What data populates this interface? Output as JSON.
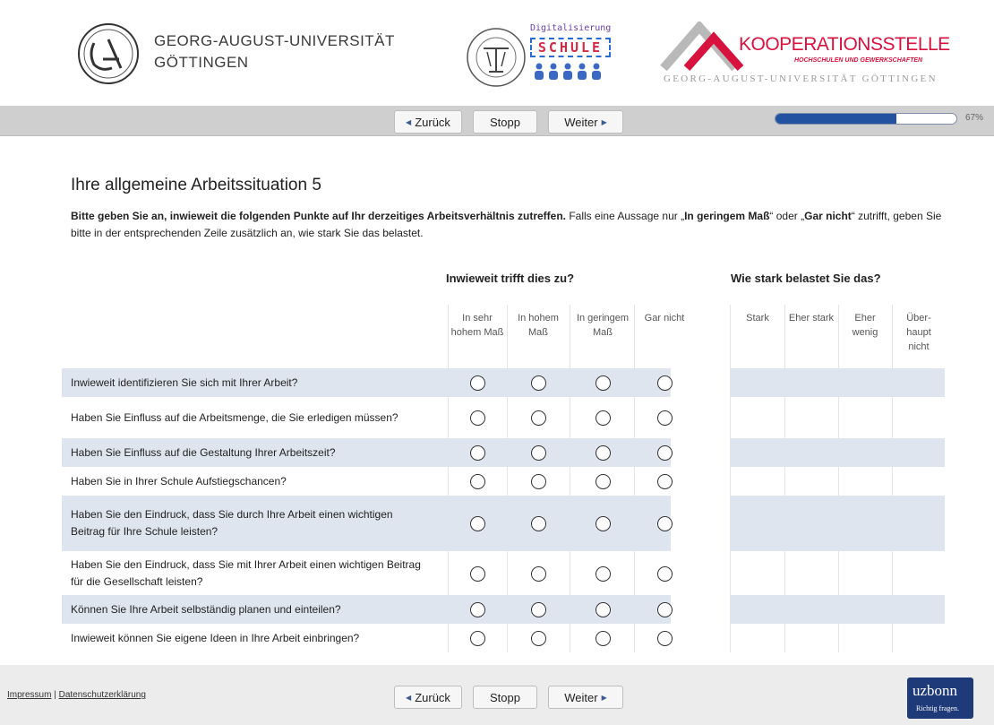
{
  "header": {
    "university_name_line1": "GEORG-AUGUST-UNIVERSITÄT",
    "university_name_line2": "GÖTTINGEN",
    "digital_logo_title": "Digitalisierung",
    "digital_logo_word": "SCHULE",
    "koop_title": "KOOPERATIONSSTELLE",
    "koop_subtitle": "HOCHSCHULEN UND GEWERKSCHAFTEN",
    "koop_university": "GEORG-AUGUST-UNIVERSITÄT GÖTTINGEN"
  },
  "nav": {
    "back_label": "Zurück",
    "stop_label": "Stopp",
    "next_label": "Weiter",
    "progress_value": 0.67,
    "progress_text": "67%"
  },
  "main": {
    "title": "Ihre allgemeine Arbeitssituation 5",
    "intro_bold": "Bitte geben Sie an, inwieweit die folgenden Punkte auf Ihr derzeitiges Arbeitsverhältnis zutreffen.",
    "intro_text1": " Falls eine Aussage nur „",
    "intro_bold2": "In geringem Maß",
    "intro_text2": "“ oder „",
    "intro_bold3": "Gar nicht",
    "intro_text3": "“ zutrifft, geben Sie bitte in der entsprechenden Zeile zusätzlich an, wie stark Sie das belastet.",
    "group1_title": "Inwieweit trifft dies zu?",
    "group2_title": "Wie stark belastet Sie das?",
    "scale1": [
      "In sehr hohem Maß",
      "In hohem Maß",
      "In geringem Maß",
      "Gar nicht"
    ],
    "scale2": [
      "Stark",
      "Eher stark",
      "Eher wenig",
      "Über-haupt nicht"
    ],
    "questions": [
      "Inwieweit identifizieren Sie sich mit Ihrer Arbeit?",
      "Haben Sie Einfluss auf die Arbeitsmenge, die Sie erledigen müssen?",
      "Haben Sie Einfluss auf die Gestaltung Ihrer Arbeitszeit?",
      "Haben Sie in Ihrer Schule Aufstiegschancen?",
      "Haben Sie den Eindruck, dass Sie durch Ihre Arbeit einen wichtigen Beitrag für Ihre Schule leisten?",
      "Haben Sie den Eindruck, dass Sie mit Ihrer Arbeit einen wichtigen Beitrag für die Gesellschaft leisten?",
      "Können Sie Ihre Arbeit selbständig planen und einteilen?",
      "Inwieweit können Sie eigene Ideen in Ihre Arbeit einbringen?"
    ]
  },
  "footer": {
    "impressum": "Impressum",
    "separator": "|",
    "privacy": "Datenschutzerklärung",
    "uz_logo_word": "uzbonn",
    "uz_logo_tagline": "Richtig fragen."
  }
}
